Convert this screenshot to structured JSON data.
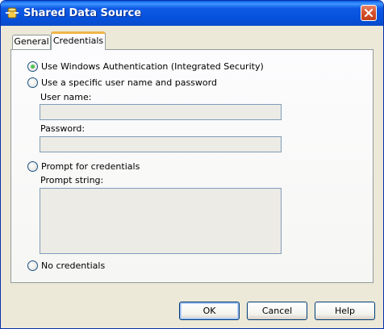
{
  "window": {
    "title": "Shared Data Source",
    "icon": "data-source-icon",
    "close_icon": "close-icon"
  },
  "tabs": [
    {
      "label": "General",
      "selected": false
    },
    {
      "label": "Credentials",
      "selected": true
    }
  ],
  "credentials": {
    "options": [
      {
        "label": "Use Windows Authentication (Integrated Security)",
        "checked": true
      },
      {
        "label": "Use a specific user name and password",
        "checked": false
      },
      {
        "label": "Prompt for credentials",
        "checked": false
      },
      {
        "label": "No credentials",
        "checked": false
      }
    ],
    "username_label": "User name:",
    "username_value": "",
    "password_label": "Password:",
    "password_value": "",
    "prompt_label": "Prompt string:",
    "prompt_value": ""
  },
  "buttons": {
    "ok": "OK",
    "cancel": "Cancel",
    "help": "Help"
  },
  "colors": {
    "titlebar": "#0a5fe8",
    "dialog_bg": "#ece9d8",
    "tab_highlight": "#f1b548",
    "radio_checked": "#21a121"
  }
}
